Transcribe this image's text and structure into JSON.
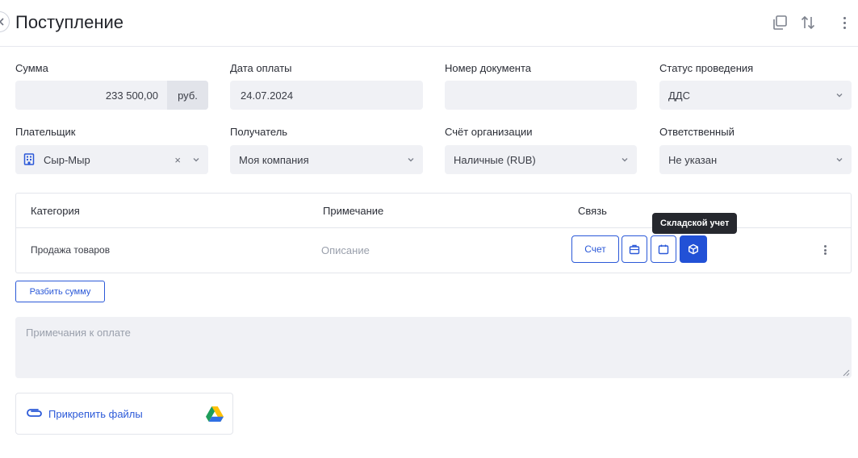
{
  "header": {
    "title": "Поступление",
    "icons": [
      "back-icon",
      "copy-icon",
      "swap-icon",
      "more-vertical-icon"
    ]
  },
  "fields": {
    "amount": {
      "label": "Сумма",
      "value": "233 500,00",
      "currency": "руб."
    },
    "payment_date": {
      "label": "Дата оплаты",
      "value": "24.07.2024"
    },
    "document_number": {
      "label": "Номер документа",
      "value": ""
    },
    "status": {
      "label": "Статус проведения",
      "value": "ДДС"
    },
    "payer": {
      "label": "Плательщик",
      "value": "Сыр-Мыр",
      "clear": "×"
    },
    "recipient": {
      "label": "Получатель",
      "value": "Моя компания"
    },
    "account": {
      "label": "Счёт организации",
      "value": "Наличные (RUB)"
    },
    "responsible": {
      "label": "Ответственный",
      "value": "Не указан"
    }
  },
  "table": {
    "headers": {
      "category": "Категория",
      "note": "Примечание",
      "link": "Связь"
    },
    "rows": [
      {
        "category": "Продажа товаров",
        "note_placeholder": "Описание",
        "invoice_label": "Счет"
      }
    ],
    "tooltip": "Складской учет"
  },
  "split_button": "Разбить сумму",
  "notes": {
    "placeholder": "Примечания к оплате",
    "value": ""
  },
  "attach": {
    "label": "Прикрепить файлы"
  },
  "colors": {
    "accent": "#2251d6",
    "field_bg": "#f0f1f5",
    "tooltip_bg": "#26282e"
  }
}
